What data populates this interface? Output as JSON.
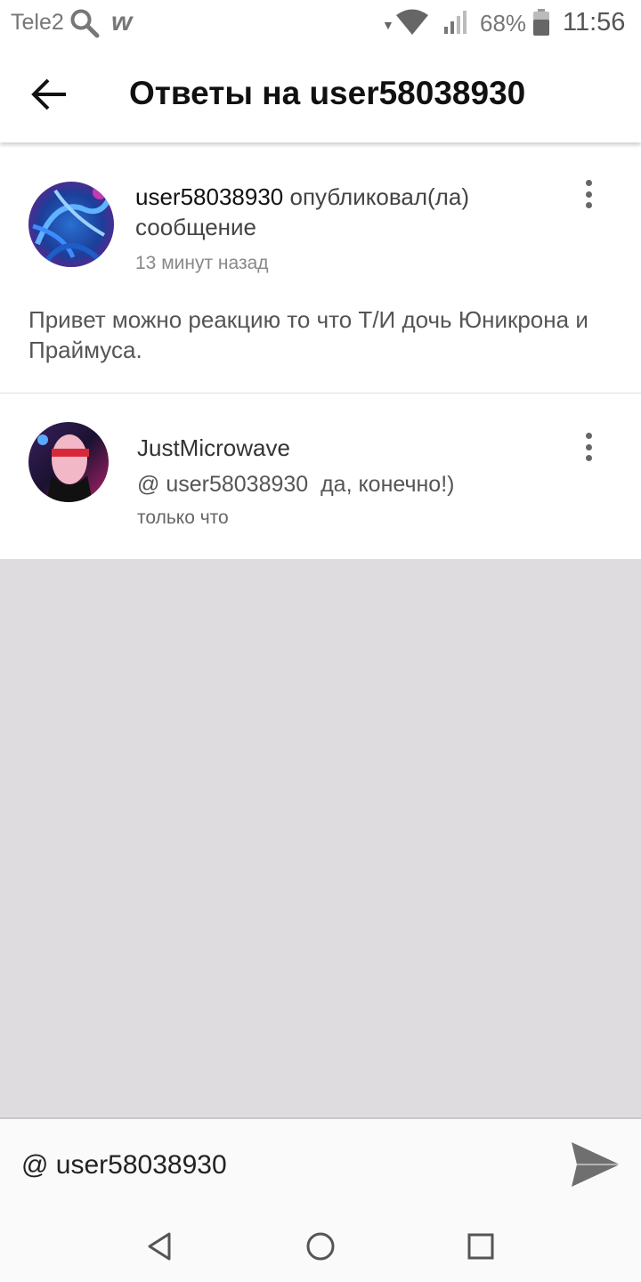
{
  "status_bar": {
    "carrier": "Tele2",
    "battery": "68%",
    "time": "11:56",
    "icons": [
      "search-icon",
      "wattpad-icon",
      "data-arrows-icon",
      "wifi-icon",
      "signal-icon",
      "battery-icon"
    ]
  },
  "header": {
    "title": "Ответы на user58038930",
    "back_icon": "arrow-left-icon"
  },
  "post": {
    "username": "user58038930",
    "action": "опубликовал(ла) сообщение",
    "time": "13 минут назад",
    "body": "Привет можно реакцию то что Т/И дочь Юникрона и Праймуса.",
    "menu_icon": "more-vertical-icon"
  },
  "reply": {
    "username": "JustMicrowave",
    "text": "@ user58038930  да, конечно!)",
    "time": "только что",
    "menu_icon": "more-vertical-icon"
  },
  "composer": {
    "value": "@ user58038930",
    "send_icon": "send-icon"
  },
  "nav_bar": {
    "icons": [
      "nav-back-icon",
      "nav-home-icon",
      "nav-recents-icon"
    ]
  },
  "colors": {
    "empty_area": "#dedcdf",
    "text_primary": "#111111",
    "text_secondary": "#888888"
  }
}
